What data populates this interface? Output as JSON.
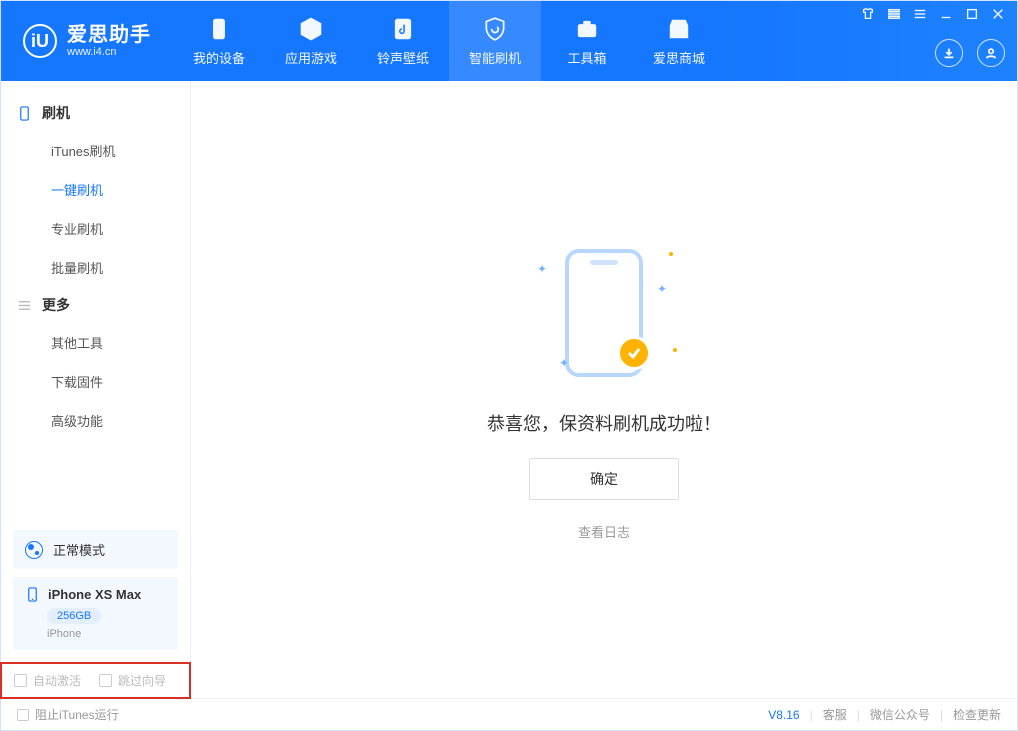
{
  "app": {
    "name_cn": "爱思助手",
    "name_en": "www.i4.cn",
    "logo_letter": "iU"
  },
  "tabs": [
    {
      "label": "我的设备"
    },
    {
      "label": "应用游戏"
    },
    {
      "label": "铃声壁纸"
    },
    {
      "label": "智能刷机",
      "active": true
    },
    {
      "label": "工具箱"
    },
    {
      "label": "爱思商城"
    }
  ],
  "sidebar": {
    "group1": {
      "title": "刷机",
      "items": [
        "iTunes刷机",
        "一键刷机",
        "专业刷机",
        "批量刷机"
      ],
      "active_index": 1
    },
    "group2": {
      "title": "更多",
      "items": [
        "其他工具",
        "下载固件",
        "高级功能"
      ]
    }
  },
  "mode": {
    "label": "正常模式"
  },
  "device": {
    "name": "iPhone XS Max",
    "storage": "256GB",
    "type": "iPhone"
  },
  "checks": {
    "auto_activate": "自动激活",
    "skip_guide": "跳过向导"
  },
  "main": {
    "success": "恭喜您，保资料刷机成功啦！",
    "ok": "确定",
    "view_log": "查看日志"
  },
  "statusbar": {
    "block_itunes": "阻止iTunes运行",
    "version": "V8.16",
    "support": "客服",
    "wechat": "微信公众号",
    "update": "检查更新"
  }
}
